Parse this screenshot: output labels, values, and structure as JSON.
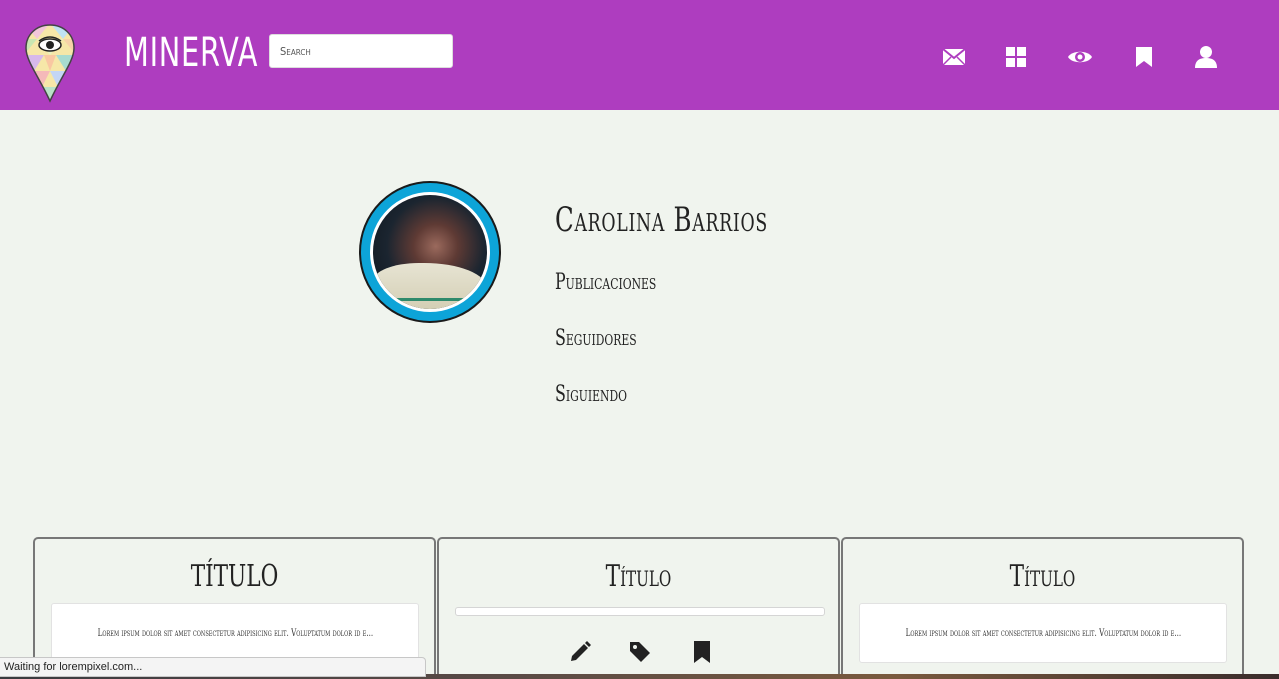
{
  "header": {
    "brand": "MINERVA",
    "search_placeholder": "Search",
    "nav_icons": [
      "envelope-icon",
      "grid-icon",
      "eye-icon",
      "bookmark-icon",
      "user-icon"
    ]
  },
  "colors": {
    "header_bg": "#ae3dbf",
    "page_bg": "#f0f4ee",
    "avatar_ring": "#0da4d8"
  },
  "profile": {
    "name": "Carolina Barrios",
    "stats": [
      "Publicaciones",
      "Seguidores",
      "Siguiendo"
    ]
  },
  "cards": [
    {
      "title": "TÍTULO",
      "text": "Lorem ipsum dolor sit amet consectetur adipisicing elit. Voluptatum dolor id e..."
    },
    {
      "title": "Título",
      "actions": [
        "pencil-icon",
        "tag-icon",
        "bookmark-icon"
      ]
    },
    {
      "title": "Título",
      "text": "Lorem ipsum dolor sit amet consectetur adipisicing elit. Voluptatum dolor id e..."
    }
  ],
  "status_bar": "Waiting for lorempixel.com..."
}
